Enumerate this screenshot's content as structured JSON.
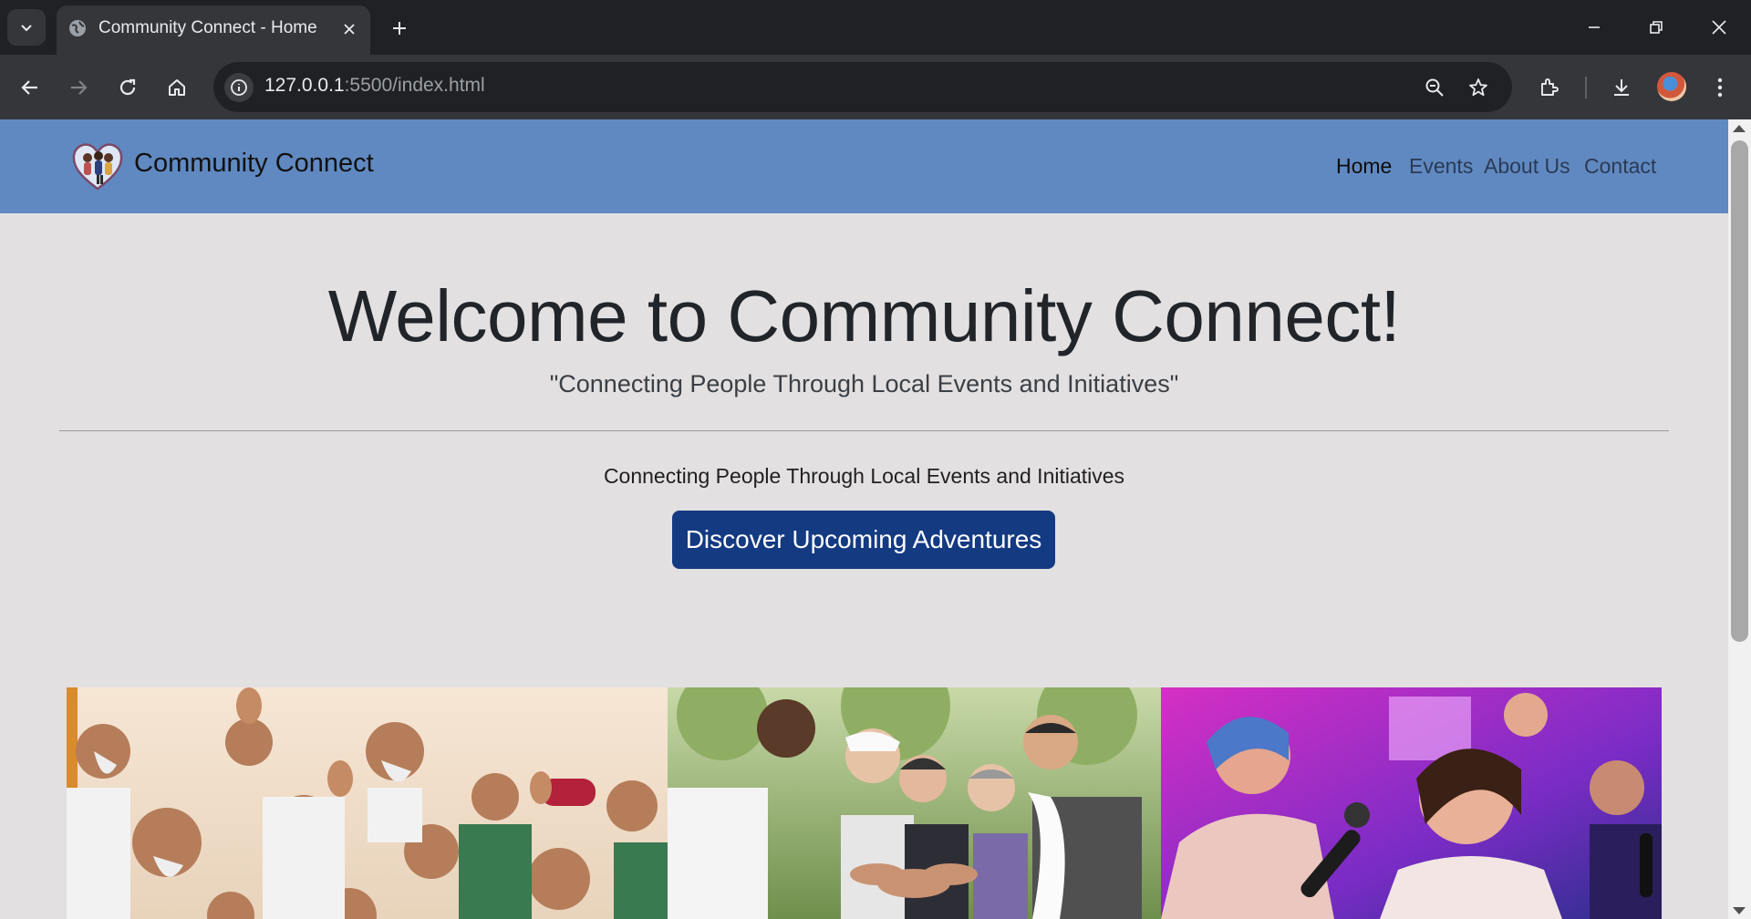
{
  "browser": {
    "tab_title": "Community Connect - Home",
    "url_host": "127.0.0.1",
    "url_path": ":5500/index.html",
    "icons": [
      "tab-search-icon",
      "globe-icon",
      "close-icon",
      "plus-icon",
      "minimize-icon",
      "restore-icon",
      "back-icon",
      "forward-icon",
      "reload-icon",
      "home-icon",
      "info-icon",
      "zoom-icon",
      "star-icon",
      "extensions-icon",
      "download-icon",
      "more-icon"
    ]
  },
  "site": {
    "brand": "Community Connect",
    "nav": [
      {
        "label": "Home"
      },
      {
        "label": "Events"
      },
      {
        "label": "About Us"
      },
      {
        "label": "Contact"
      }
    ]
  },
  "hero": {
    "title": "Welcome to Community Connect!",
    "quote": "\"Connecting People Through Local Events and Initiatives\"",
    "tagline": "Connecting People Through Local Events and Initiatives",
    "cta": "Discover Upcoming Adventures"
  },
  "colors": {
    "navbar": "#6089c1",
    "page_bg": "#e3e0e1",
    "cta_bg": "#143a82"
  }
}
